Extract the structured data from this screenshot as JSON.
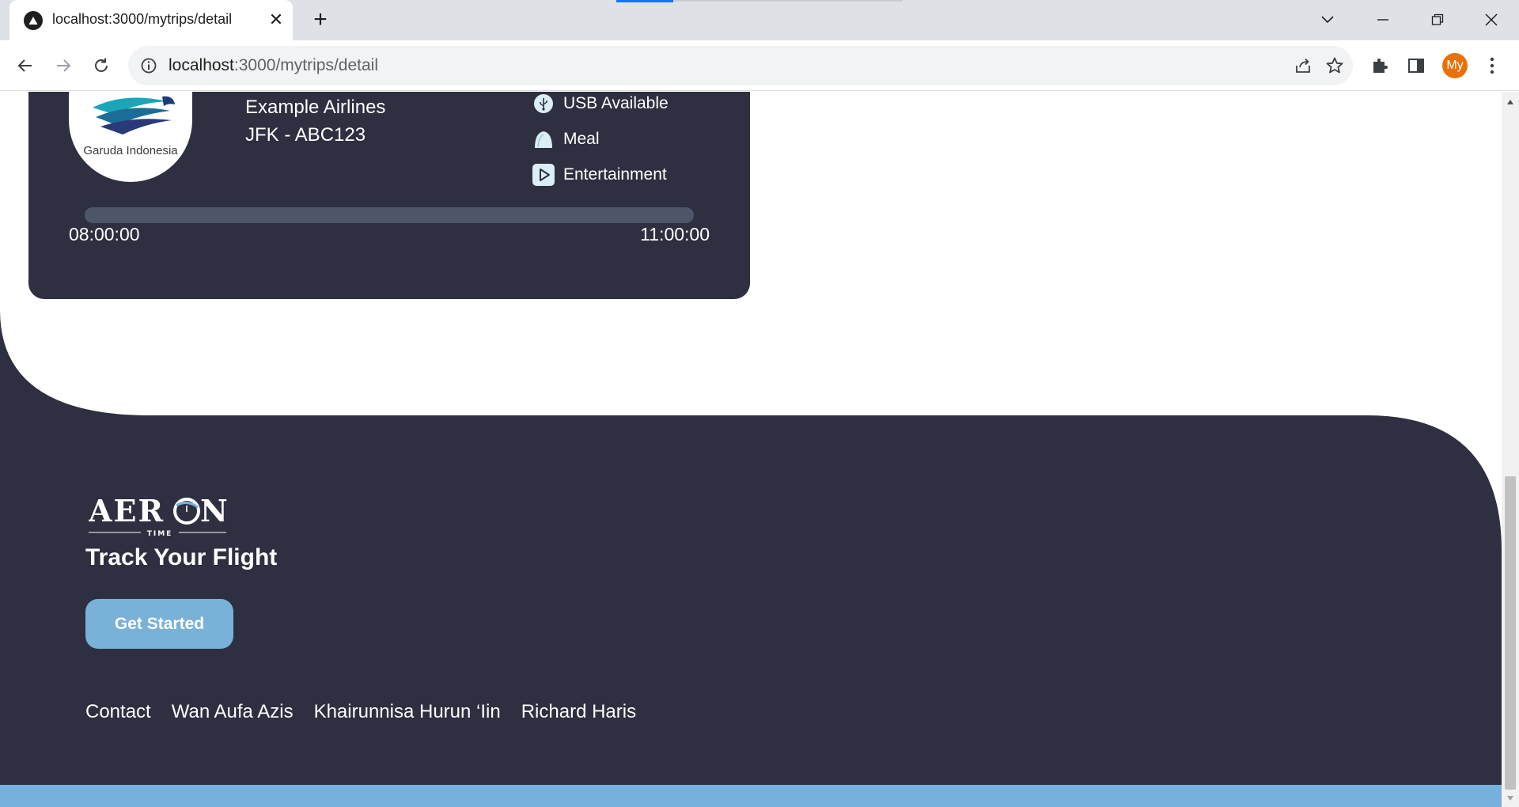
{
  "browser": {
    "tab_title": "localhost:3000/mytrips/detail",
    "url_host": "localhost",
    "url_path": ":3000/mytrips/detail",
    "avatar_initials": "My"
  },
  "flight_card": {
    "airline_logo_text": "Garuda Indonesia",
    "airline_name": "Example Airlines",
    "flight_code": "JFK - ABC123",
    "amenities": [
      {
        "label": "USB Available",
        "icon": "usb-icon"
      },
      {
        "label": "Meal",
        "icon": "meal-icon"
      },
      {
        "label": "Entertainment",
        "icon": "play-icon"
      }
    ],
    "departure_time": "08:00:00",
    "arrival_time": "11:00:00",
    "progress_fraction": 0
  },
  "footer": {
    "brand_logo_text": "AERON",
    "brand_logo_subtext": "TIME",
    "tagline": "Track Your Flight",
    "cta_label": "Get Started",
    "links": [
      "Contact",
      "Wan Aufa Azis",
      "Khairunnisa Hurun ‘Iin",
      "Richard Haris"
    ]
  },
  "colors": {
    "card_bg": "#2e2f40",
    "footer_bg": "#2e2f40",
    "accent": "#79b1d9",
    "progress_track": "#4d5569"
  }
}
